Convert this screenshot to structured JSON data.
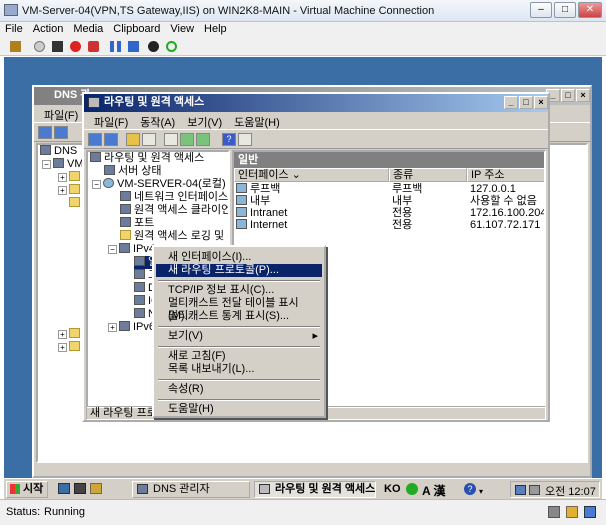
{
  "vm": {
    "title": "VM-Server-04(VPN,TS Gateway,IIS) on WIN2K8-MAIN - Virtual Machine Connection",
    "menu": [
      "File",
      "Action",
      "Media",
      "Clipboard",
      "View",
      "Help"
    ],
    "status_label": "Status:",
    "status_value": "Running"
  },
  "dns_window": {
    "title": "DNS 관",
    "menu_file": "파일(F)",
    "tree": [
      "DNS",
      "VM"
    ]
  },
  "rras_window": {
    "title": "라우팅 및 원격 액세스",
    "menu": [
      "파일(F)",
      "동작(A)",
      "보기(V)",
      "도움말(H)"
    ],
    "tree": {
      "root": "라우팅 및 원격 액세스",
      "server_status": "서버 상태",
      "server": "VM-SERVER-04(로컬)",
      "network_interfaces": "네트워크 인터페이스",
      "remote_clients": "원격 액세스 클라이언트",
      "ports": "포트",
      "logging": "원격 액세스 로깅 및 정책",
      "ipv4": "IPv4",
      "ipv4_general": "일반",
      "ipv4_child2": "고",
      "ipv4_child3": "DI",
      "ipv4_child4": "IG",
      "ipv4_child5": "N",
      "ipv6": "IPv6"
    },
    "pane_header": "일반",
    "columns": [
      "인터페이스",
      "종류",
      "IP 주소"
    ],
    "rows": [
      {
        "iface": "루프백",
        "type": "루프백",
        "ip": "127.0.0.1"
      },
      {
        "iface": "내부",
        "type": "내부",
        "ip": "사용할 수 없음"
      },
      {
        "iface": "Intranet",
        "type": "전용",
        "ip": "172.16.100.204"
      },
      {
        "iface": "Internet",
        "type": "전용",
        "ip": "61.107.72.171"
      }
    ],
    "statusbar": "새 라우팅 프로토"
  },
  "context_menu": {
    "items": [
      "새 인터페이스(I)...",
      "새 라우팅 프로토콜(P)...",
      "TCP/IP 정보 표시(C)...",
      "멀티캐스트 전달 테이블 표시(M)...",
      "멀티캐스트 통계 표시(S)...",
      "보기(V)",
      "새로 고침(F)",
      "목록 내보내기(L)...",
      "속성(R)",
      "도움말(H)"
    ],
    "highlighted_index": 1
  },
  "taskbar": {
    "start": "시작",
    "btn_dns": "DNS 관리자",
    "btn_rras": "라우팅 및 원격 액세스",
    "lang": "KO",
    "ime": "A 漢",
    "time": "오전 12:07"
  }
}
